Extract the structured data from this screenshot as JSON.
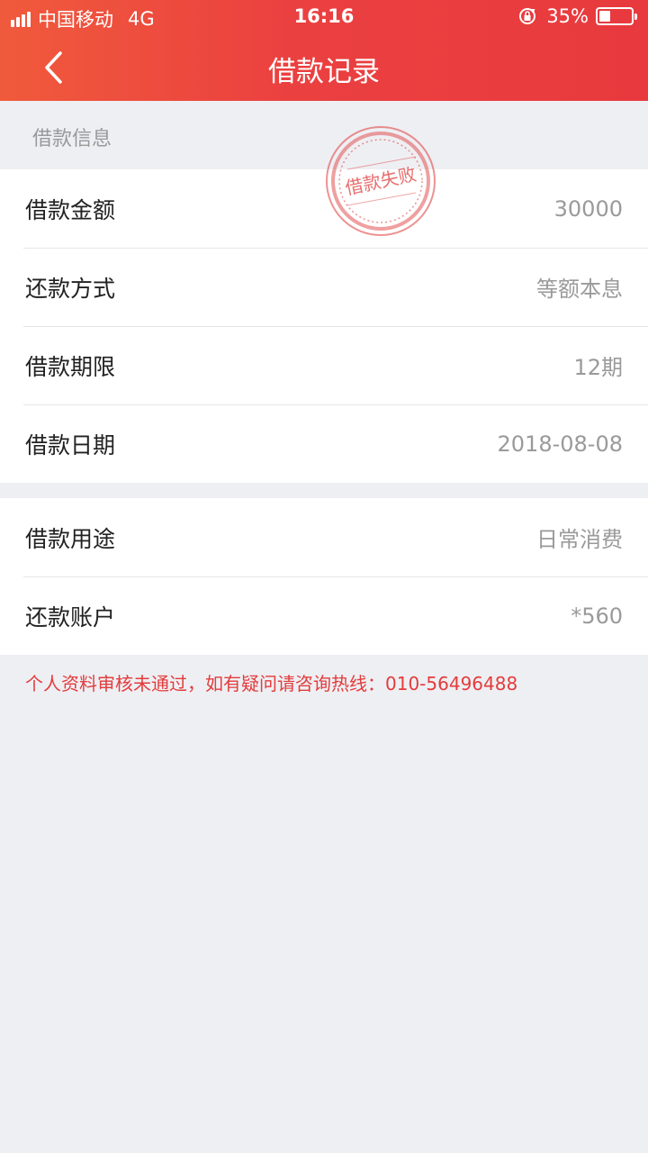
{
  "status_bar": {
    "carrier": "中国移动",
    "network": "4G",
    "time": "16:16",
    "battery": "35%",
    "battery_level": 0.35
  },
  "nav": {
    "title": "借款记录",
    "back_icon": "chevron-left-icon"
  },
  "section": {
    "title": "借款信息"
  },
  "stamp": {
    "text": "借款失败",
    "color": "#e04a4a"
  },
  "card1": {
    "rows": [
      {
        "label": "借款金额",
        "value": "30000"
      },
      {
        "label": "还款方式",
        "value": "等额本息"
      },
      {
        "label": "借款期限",
        "value": "12期"
      },
      {
        "label": "借款日期",
        "value": "2018-08-08"
      }
    ]
  },
  "card2": {
    "rows": [
      {
        "label": "借款用途",
        "value": "日常消费"
      },
      {
        "label": "还款账户",
        "value": "*560"
      }
    ]
  },
  "notice": "个人资料审核未通过，如有疑问请咨询热线：010-56496488",
  "colors": {
    "header_start": "#f05a3c",
    "header_end": "#e83a3e",
    "accent": "#e33c3c",
    "background": "#eeeff3"
  }
}
